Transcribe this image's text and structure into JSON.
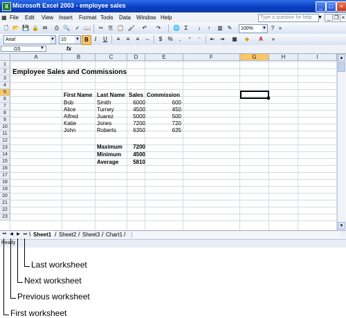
{
  "window": {
    "title": "Microsoft Excel 2003 - employee sales",
    "app_icon": "excel-icon"
  },
  "menu": {
    "items": [
      "File",
      "Edit",
      "View",
      "Insert",
      "Format",
      "Tools",
      "Data",
      "Window",
      "Help"
    ],
    "help_placeholder": "Type a question for help"
  },
  "toolbar": {
    "zoom": "100%",
    "font": "Arial",
    "size": "10"
  },
  "formula": {
    "name_box": "G5",
    "fx": "fx"
  },
  "sheet": {
    "columns": [
      "A",
      "B",
      "C",
      "D",
      "E",
      "F",
      "G",
      "H",
      "I"
    ],
    "selected_column": "G",
    "selected_row": 5,
    "rows": [
      "1",
      "2",
      "3",
      "4",
      "5",
      "6",
      "7",
      "8",
      "9",
      "10",
      "11",
      "12",
      "13",
      "14",
      "15",
      "16",
      "17",
      "18",
      "19",
      "20",
      "21",
      "22",
      "23"
    ],
    "title": "Employee Sales and Commissions",
    "headers": [
      "First Name",
      "Last Name",
      "Sales",
      "Commission"
    ],
    "employees": [
      [
        "Bob",
        "Smith",
        "6000",
        "600"
      ],
      [
        "Alice",
        "Turney",
        "4500",
        "450"
      ],
      [
        "Alfred",
        "Juarez",
        "5000",
        "500"
      ],
      [
        "Katie",
        "Jones",
        "7200",
        "720"
      ],
      [
        "John",
        "Roberts",
        "6350",
        "635"
      ]
    ],
    "summary": [
      [
        "Maximum",
        "7200"
      ],
      [
        "Minimum",
        "4500"
      ],
      [
        "Average",
        "5810"
      ]
    ]
  },
  "tabs": {
    "sheets": [
      "Sheet1",
      "Sheet2",
      "Sheet3",
      "Chart1"
    ],
    "active": "Sheet1"
  },
  "status": {
    "text": "Ready"
  },
  "callouts": [
    "Last worksheet",
    "Next worksheet",
    "Previous worksheet",
    "First worksheet"
  ]
}
